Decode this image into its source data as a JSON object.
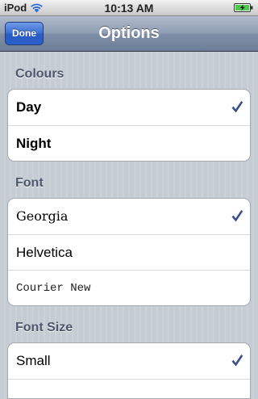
{
  "status_bar": {
    "carrier": "iPod",
    "time": "10:13 AM"
  },
  "nav": {
    "title": "Options",
    "done_label": "Done"
  },
  "colours_section": {
    "header": "Colours",
    "items": [
      {
        "label": "Day",
        "selected": true
      },
      {
        "label": "Night",
        "selected": false
      }
    ]
  },
  "font_section": {
    "header": "Font",
    "items": [
      {
        "label": "Georgia",
        "selected": true
      },
      {
        "label": "Helvetica",
        "selected": false
      },
      {
        "label": "Courier New",
        "selected": false
      }
    ]
  },
  "font_size_section": {
    "header": "Font Size",
    "items": [
      {
        "label": "Small",
        "selected": true
      }
    ]
  },
  "colors": {
    "checkmark": "#3a5289",
    "nav_button": "#2b5ec8",
    "section_header": "#4c566c"
  },
  "icons": {
    "wifi": "wifi-icon",
    "battery": "battery-charging-icon",
    "check": "checkmark-icon"
  }
}
